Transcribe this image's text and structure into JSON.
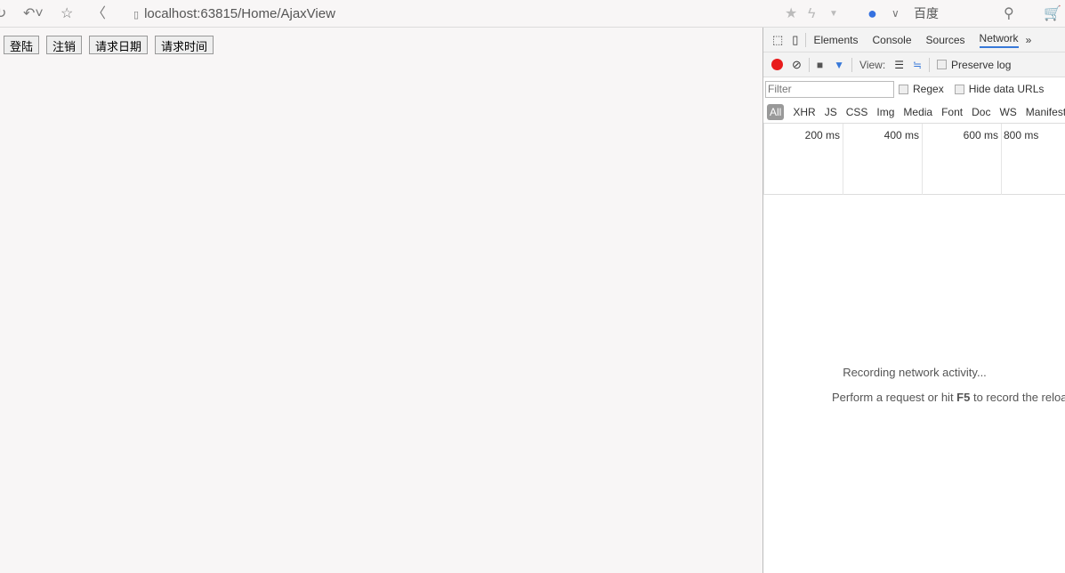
{
  "browser": {
    "url": "localhost:63815/Home/AjaxView",
    "search_engine": "百度"
  },
  "page": {
    "buttons": [
      "登陆",
      "注销",
      "请求日期",
      "请求时间"
    ]
  },
  "devtools": {
    "tabs": [
      "Elements",
      "Console",
      "Sources",
      "Network"
    ],
    "active_tab": "Network",
    "view_label": "View:",
    "preserve_log": "Preserve log",
    "filter_placeholder": "Filter",
    "regex": "Regex",
    "hide_data_urls": "Hide data URLs",
    "types": [
      "All",
      "XHR",
      "JS",
      "CSS",
      "Img",
      "Media",
      "Font",
      "Doc",
      "WS",
      "Manifest"
    ],
    "ticks": [
      "200 ms",
      "400 ms",
      "600 ms",
      "800 ms"
    ],
    "recording": "Recording network activity...",
    "hint_pre": "Perform a request or hit ",
    "hint_key": "F5",
    "hint_post": " to record the reload."
  },
  "colors": {
    "record": "#e81b1b",
    "accent": "#3879d9"
  }
}
